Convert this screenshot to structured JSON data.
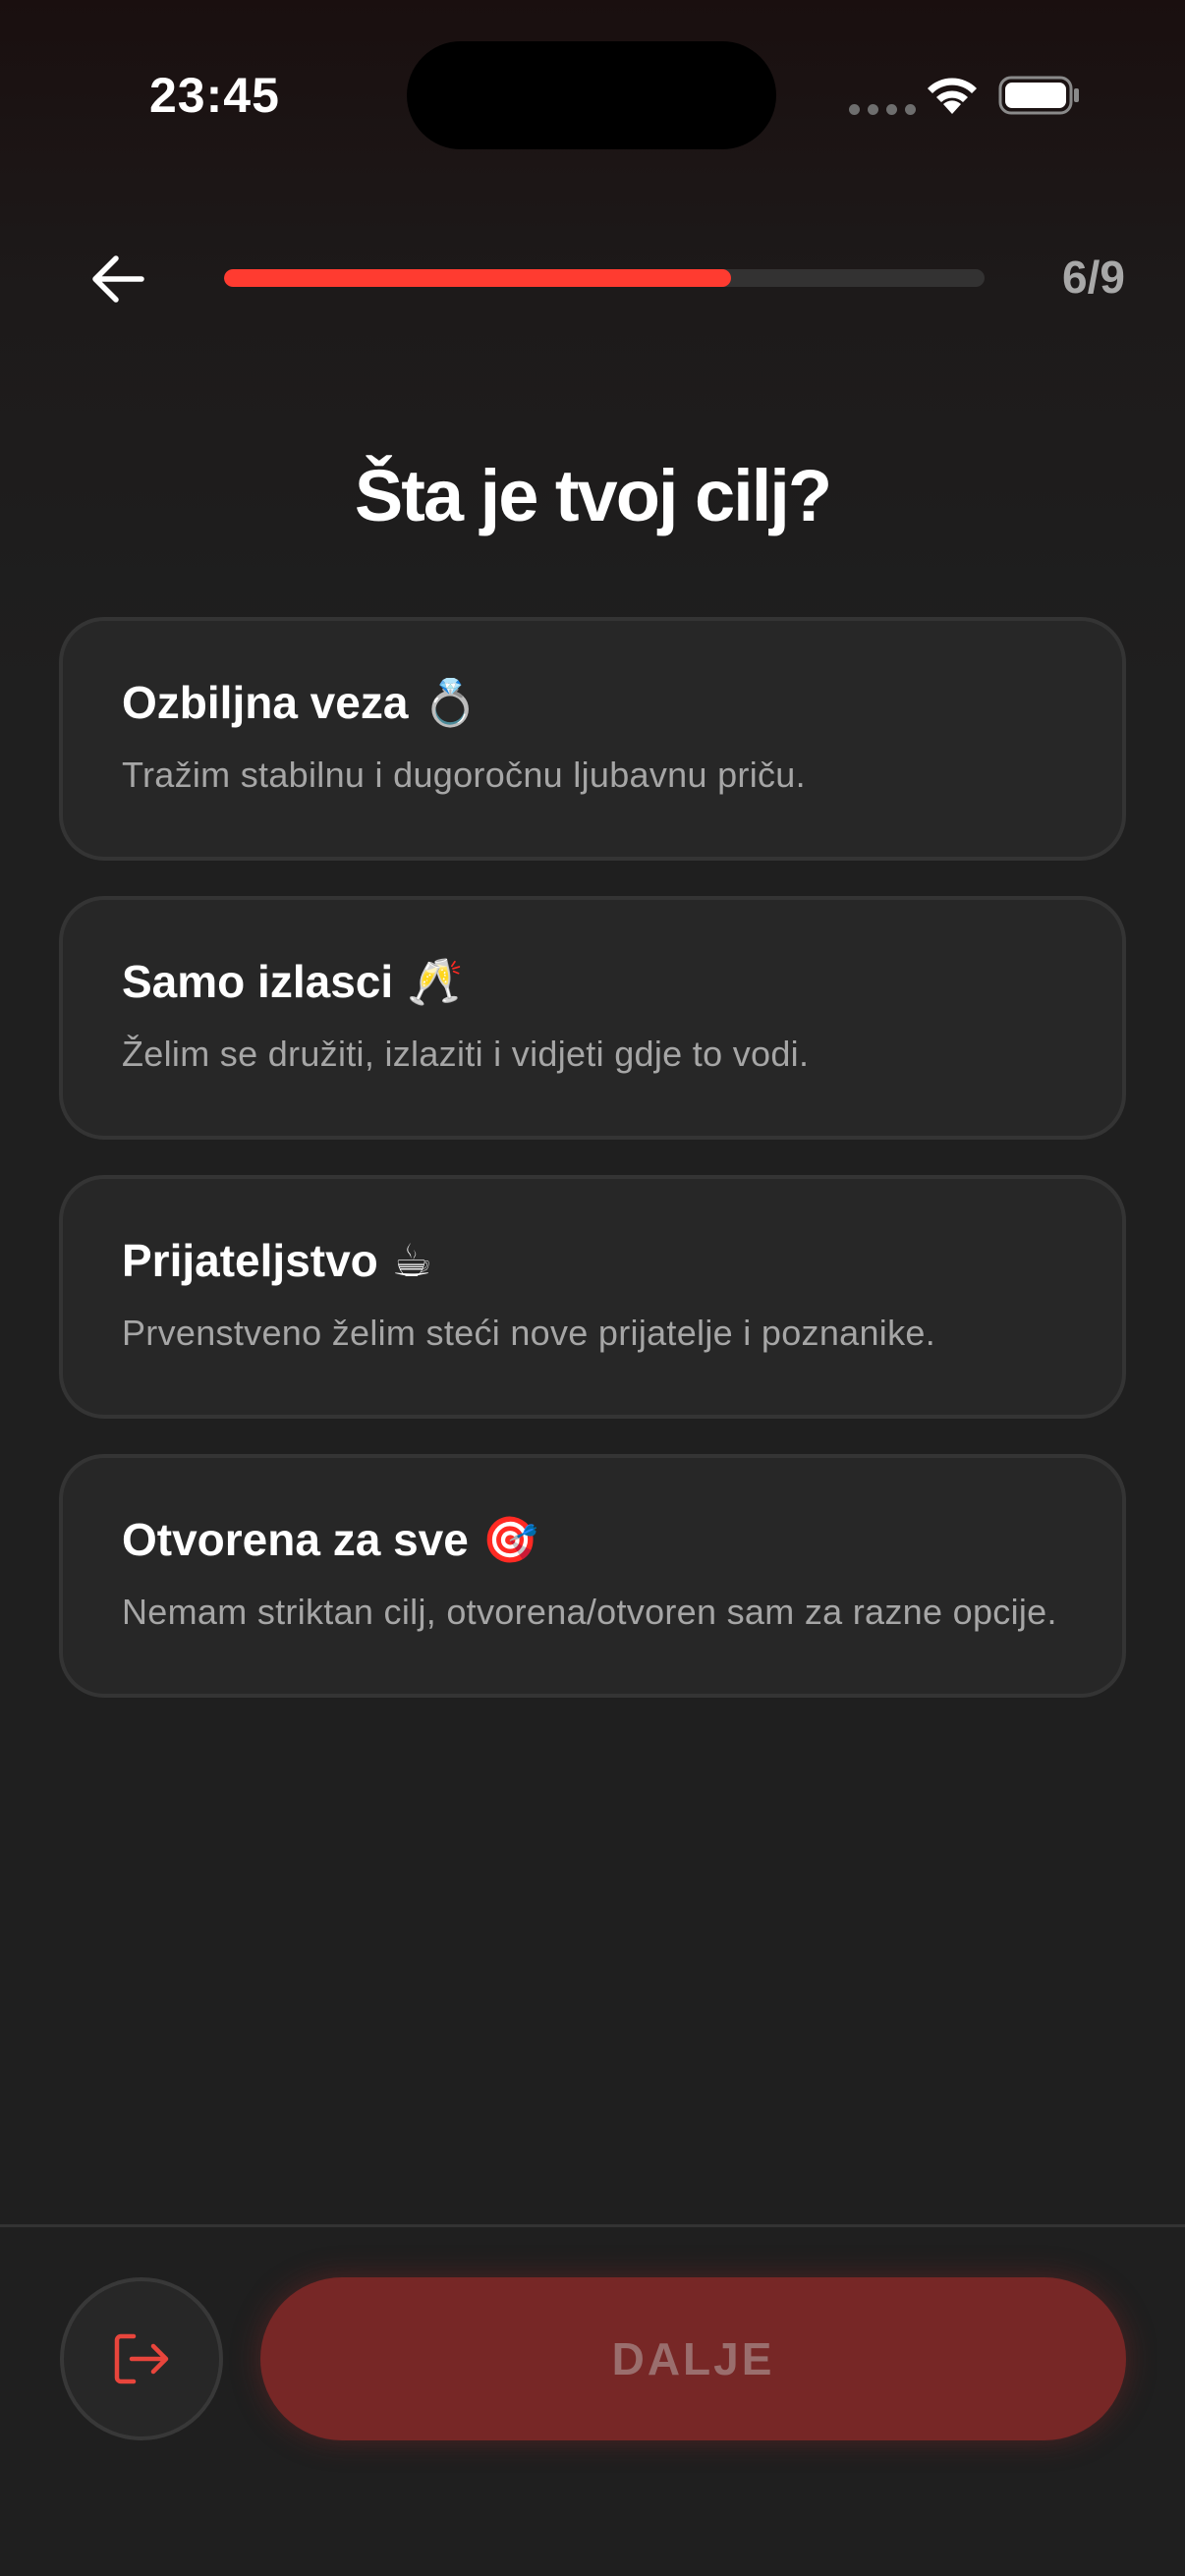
{
  "status_bar": {
    "time": "23:45"
  },
  "header": {
    "progress_fraction": 0.667,
    "step_label": "6/9"
  },
  "page": {
    "title": "Šta je tvoj cilj?"
  },
  "options": [
    {
      "title": "Ozbiljna veza",
      "emoji": "💍",
      "description": "Tražim stabilnu i dugoročnu ljubavnu priču."
    },
    {
      "title": "Samo izlasci",
      "emoji": "🥂",
      "description": "Želim se družiti, izlaziti i vidjeti gdje to vodi."
    },
    {
      "title": "Prijateljstvo",
      "emoji": "☕",
      "description": "Prvenstveno želim steći nove prijatelje i poznanike."
    },
    {
      "title": "Otvorena za sve",
      "emoji": "🎯",
      "description": "Nemam striktan cilj, otvorena/otvoren sam za razne opcije."
    }
  ],
  "footer": {
    "next_label": "DALJE"
  },
  "colors": {
    "accent": "#ff3b30",
    "next_button_bg": "#772726",
    "card_bg": "#272727"
  }
}
